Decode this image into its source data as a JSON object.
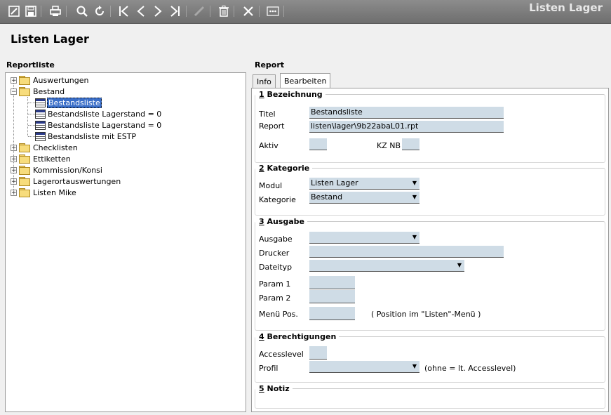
{
  "app_title": "Listen Lager",
  "page_title": "Listen Lager",
  "toolbar": {
    "icons": [
      "edit-icon",
      "save-icon",
      "print-icon",
      "search-icon",
      "refresh-icon",
      "first-record-icon",
      "previous-record-icon",
      "next-record-icon",
      "last-record-icon",
      "edit-disabled-icon",
      "delete-icon",
      "close-icon",
      "more-icon"
    ]
  },
  "reportliste": {
    "header": "Reportliste",
    "items": [
      {
        "label": "Auswertungen",
        "expander": "+"
      },
      {
        "label": "Bestand",
        "expander": "−"
      },
      {
        "label": "Bestandsliste"
      },
      {
        "label": "Bestandsliste Lagerstand = 0"
      },
      {
        "label": "Bestandsliste Lagerstand = 0"
      },
      {
        "label": "Bestandsliste mit ESTP"
      },
      {
        "label": "Checklisten",
        "expander": "+"
      },
      {
        "label": "Ettiketten",
        "expander": "+"
      },
      {
        "label": "Kommission/Konsi",
        "expander": "+"
      },
      {
        "label": "Lagerortauswertungen",
        "expander": "+"
      },
      {
        "label": "Listen Mike",
        "expander": "+"
      }
    ]
  },
  "report": {
    "header": "Report",
    "tabs": [
      {
        "label": "Info"
      },
      {
        "label": "Bearbeiten"
      }
    ],
    "g1": {
      "num": "1",
      "title": " Bezeichnung",
      "titel_label": "Titel",
      "titel_value": "Bestandsliste",
      "report_label": "Report",
      "report_value": "listen\\lager\\9b22abaL01.rpt",
      "aktiv_label": "Aktiv",
      "aktiv_value": "",
      "kznb_label": "KZ NB",
      "kznb_value": ""
    },
    "g2": {
      "num": "2",
      "title": " Kategorie",
      "modul_label": "Modul",
      "modul_value": "Listen Lager",
      "kategorie_label": "Kategorie",
      "kategorie_value": "Bestand"
    },
    "g3": {
      "num": "3",
      "title": " Ausgabe",
      "ausgabe_label": "Ausgabe",
      "ausgabe_value": "",
      "drucker_label": "Drucker",
      "drucker_value": "",
      "dateityp_label": "Dateityp",
      "dateityp_value": "",
      "param1_label": "Param 1",
      "param1_value": "",
      "param2_label": "Param 2",
      "param2_value": "",
      "menupos_label": "Menü Pos.",
      "menupos_value": "",
      "menupos_hint": "( Position im \"Listen\"-Menü )"
    },
    "g4": {
      "num": "4",
      "title": " Berechtigungen",
      "accesslevel_label": "Accesslevel",
      "accesslevel_value": "",
      "profil_label": "Profil",
      "profil_value": "",
      "profil_hint": "(ohne = lt. Accesslevel)"
    },
    "g5": {
      "num": "5",
      "title": " Notiz"
    }
  },
  "colors": {
    "field_bg": "#cfdce6",
    "selection": "#3a6ec8",
    "toolbar": "#7d7d7d"
  }
}
